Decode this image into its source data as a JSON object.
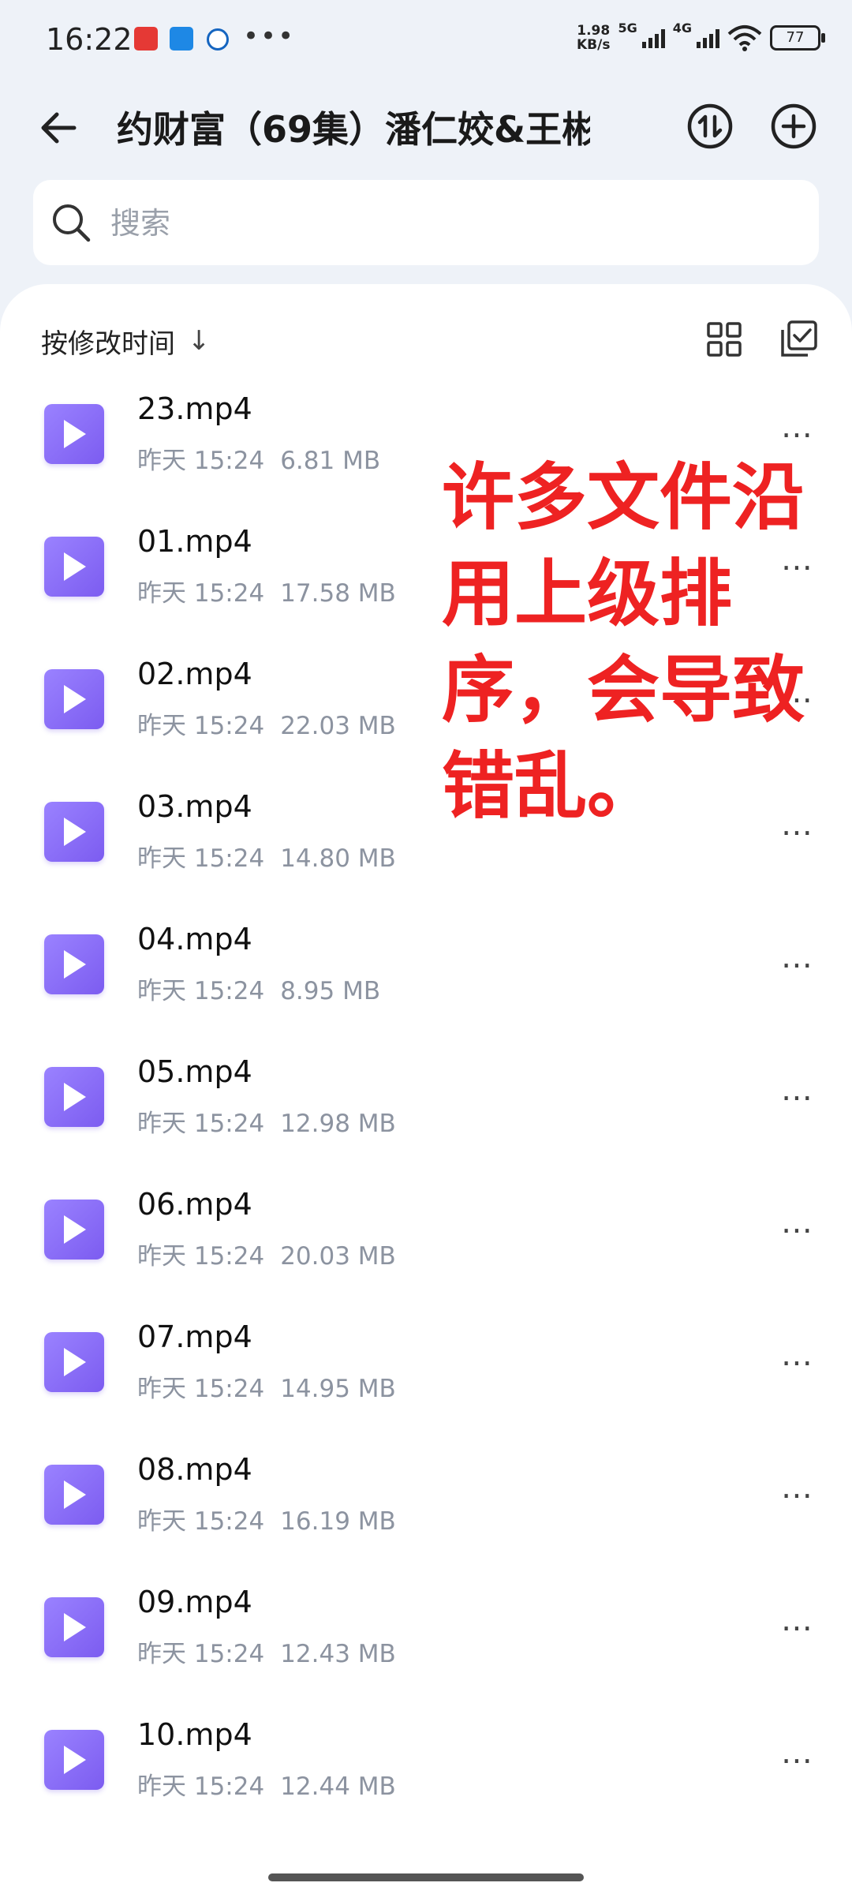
{
  "status_bar": {
    "time": "16:22",
    "speed": "1.98\nKB/s",
    "net1": "5G",
    "net2": "4G",
    "battery": "77"
  },
  "header": {
    "title": "约财富（69集）潘仁姣&王彬"
  },
  "search": {
    "placeholder": "搜索"
  },
  "sort": {
    "label": "按修改时间",
    "arrow": "↓"
  },
  "files": [
    {
      "name": "23.mp4",
      "date": "昨天 15:24",
      "size": "6.81 MB"
    },
    {
      "name": "01.mp4",
      "date": "昨天 15:24",
      "size": "17.58 MB"
    },
    {
      "name": "02.mp4",
      "date": "昨天 15:24",
      "size": "22.03 MB"
    },
    {
      "name": "03.mp4",
      "date": "昨天 15:24",
      "size": "14.80 MB"
    },
    {
      "name": "04.mp4",
      "date": "昨天 15:24",
      "size": "8.95 MB"
    },
    {
      "name": "05.mp4",
      "date": "昨天 15:24",
      "size": "12.98 MB"
    },
    {
      "name": "06.mp4",
      "date": "昨天 15:24",
      "size": "20.03 MB"
    },
    {
      "name": "07.mp4",
      "date": "昨天 15:24",
      "size": "14.95 MB"
    },
    {
      "name": "08.mp4",
      "date": "昨天 15:24",
      "size": "16.19 MB"
    },
    {
      "name": "09.mp4",
      "date": "昨天 15:24",
      "size": "12.43 MB"
    },
    {
      "name": "10.mp4",
      "date": "昨天 15:24",
      "size": "12.44 MB"
    }
  ],
  "more_label": "⋯",
  "annotation": "许多文件沿用上级排序，会导致错乱。",
  "colors": {
    "accent_purple": "#8a6ff7",
    "annotation_red": "#ee2222",
    "meta_gray": "#8c93a0"
  }
}
